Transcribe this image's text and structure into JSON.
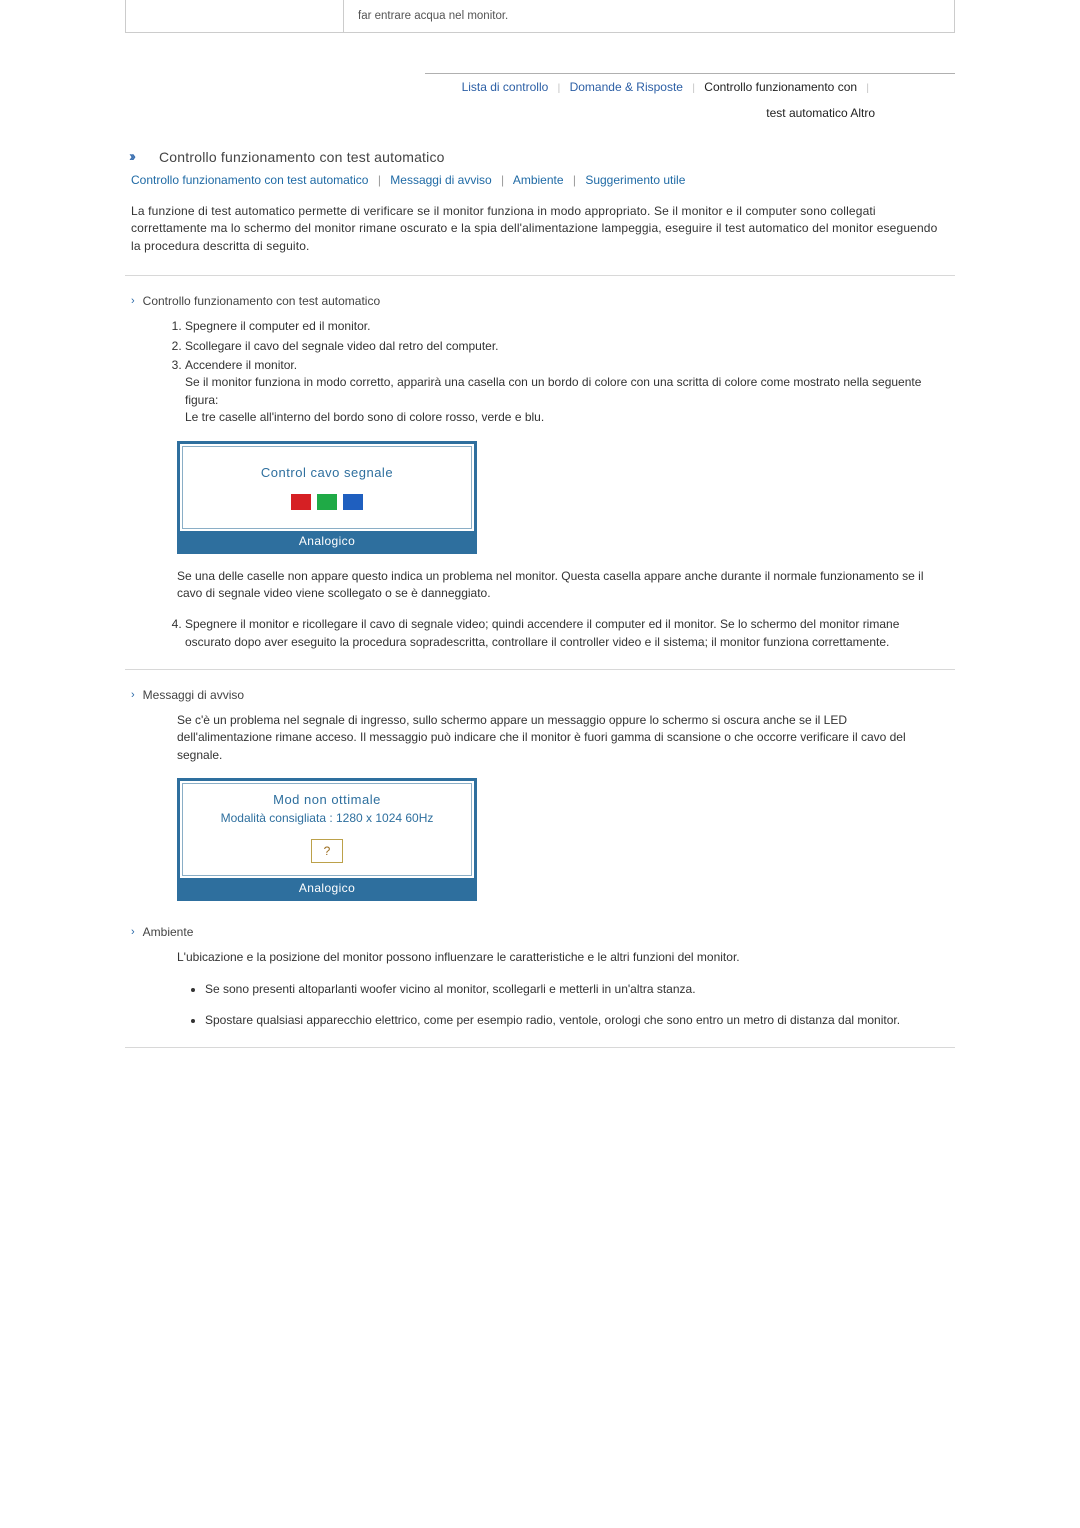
{
  "top_box": {
    "text": "far entrare acqua nel monitor."
  },
  "nav": {
    "link1": "Lista di controllo",
    "link2": "Domande & Risposte",
    "active": "Controllo funzionamento con",
    "active_line2": "test automatico Altro"
  },
  "main_title": "Controllo funzionamento con test automatico",
  "sub_nav": {
    "a": "Controllo funzionamento con test automatico",
    "b": "Messaggi di avviso",
    "c": "Ambiente",
    "d": "Suggerimento utile"
  },
  "intro": "La funzione di test automatico permette di verificare se il monitor funziona in modo appropriato. Se il monitor e il computer sono collegati correttamente ma lo schermo del monitor rimane oscurato e la spia dell'alimentazione lampeggia, eseguire il test automatico del monitor eseguendo la procedura descritta di seguito.",
  "section1": {
    "title": "Controllo funzionamento con test automatico",
    "li1": "Spegnere il computer ed il monitor.",
    "li2": "Scollegare il cavo del segnale video dal retro del computer.",
    "li3_a": "Accendere il monitor.",
    "li3_b": "Se il monitor funziona in modo corretto, apparirà una casella con un bordo di colore con una scritta di colore come mostrato nella seguente figura:",
    "li3_c": "Le tre caselle all'interno del bordo sono di colore rosso, verde e blu.",
    "dialog_title": "Control cavo segnale",
    "dialog_footer": "Analogico",
    "after_dialog": "Se una delle caselle non appare questo indica un problema nel monitor. Questa casella appare anche durante il normale funzionamento se il cavo di segnale video viene scollegato o se è danneggiato.",
    "li4": "Spegnere il monitor e ricollegare il cavo di segnale video; quindi accendere il computer ed il monitor. Se lo schermo del monitor rimane oscurato dopo aver eseguito la procedura sopradescritta, controllare il controller video e il sistema; il monitor funziona correttamente."
  },
  "section2": {
    "title": "Messaggi di avviso",
    "body": "Se c'è un problema nel segnale di ingresso, sullo schermo appare un messaggio oppure lo schermo si oscura anche se il LED dell'alimentazione rimane acceso. Il messaggio può indicare che il monitor è fuori gamma di scansione o che occorre verificare il cavo del segnale.",
    "dialog_title": "Mod non ottimale",
    "dialog_sub": "Modalità consigliata : 1280 x 1024  60Hz",
    "dialog_footer": "Analogico"
  },
  "section3": {
    "title": "Ambiente",
    "intro": "L'ubicazione e la posizione del monitor possono influenzare le caratteristiche e le altri funzioni del monitor.",
    "b1": "Se sono presenti altoparlanti woofer vicino al monitor, scollegarli e metterli in un'altra stanza.",
    "b2": "Spostare qualsiasi apparecchio elettrico, come per esempio radio, ventole, orologi che sono entro un metro di distanza dal monitor."
  }
}
